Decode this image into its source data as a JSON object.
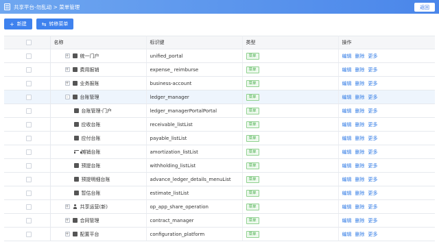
{
  "header": {
    "breadcrumb": "共享平台-勿乱动 >  菜单管理",
    "back_label": "返回"
  },
  "toolbar": {
    "new_label": "新建",
    "transfer_label": "转移菜单"
  },
  "table": {
    "columns": {
      "name": "名称",
      "key": "标识键",
      "type": "类型",
      "ops": "操作"
    },
    "ops": {
      "edit": "编辑",
      "delete": "删除",
      "more": "更多"
    },
    "type_tag": "菜单",
    "rows": [
      {
        "name": "统一门户",
        "key": "unified_portal",
        "level": 0,
        "expander": "+",
        "icon": "dashboard-icon"
      },
      {
        "name": "费用报销",
        "key": "expense_ reimburse",
        "level": 0,
        "expander": "+",
        "icon": "dashboard-icon"
      },
      {
        "name": "业务报账",
        "key": "business-account",
        "level": 0,
        "expander": "+",
        "icon": "dashboard-icon"
      },
      {
        "name": "台账管理",
        "key": "ledger_manager",
        "level": 0,
        "expander": "-",
        "icon": "ledger-icon",
        "selected": true
      },
      {
        "name": "台账管理-门户",
        "key": "ledger_managerPortalPortal",
        "level": 1,
        "icon": "portal-icon"
      },
      {
        "name": "应收台账",
        "key": "receivable_listList",
        "level": 1,
        "icon": "receivable-icon"
      },
      {
        "name": "应付台账",
        "key": "payable_listList",
        "level": 1,
        "icon": "payable-icon"
      },
      {
        "name": "摊销台账",
        "key": "amortization_listList",
        "level": 1,
        "icon": "scale-icon"
      },
      {
        "name": "预提台账",
        "key": "withholding_listList",
        "level": 1,
        "icon": "withholding-icon"
      },
      {
        "name": "预提明细台账",
        "key": "advance_ledger_details_menuList",
        "level": 1,
        "icon": "details-icon"
      },
      {
        "name": "暂估台账",
        "key": "estimate_listList",
        "level": 1,
        "icon": "estimate-icon"
      },
      {
        "name": "共享运营(新)",
        "key": "op_app_share_operation",
        "level": 0,
        "expander": "+",
        "icon": "person-icon"
      },
      {
        "name": "合同管理",
        "key": "contract_manager",
        "level": 0,
        "expander": "+",
        "icon": "contract-icon"
      },
      {
        "name": "配置平台",
        "key": "configuration_platform",
        "level": 0,
        "expander": "+",
        "icon": "config-icon"
      }
    ]
  }
}
